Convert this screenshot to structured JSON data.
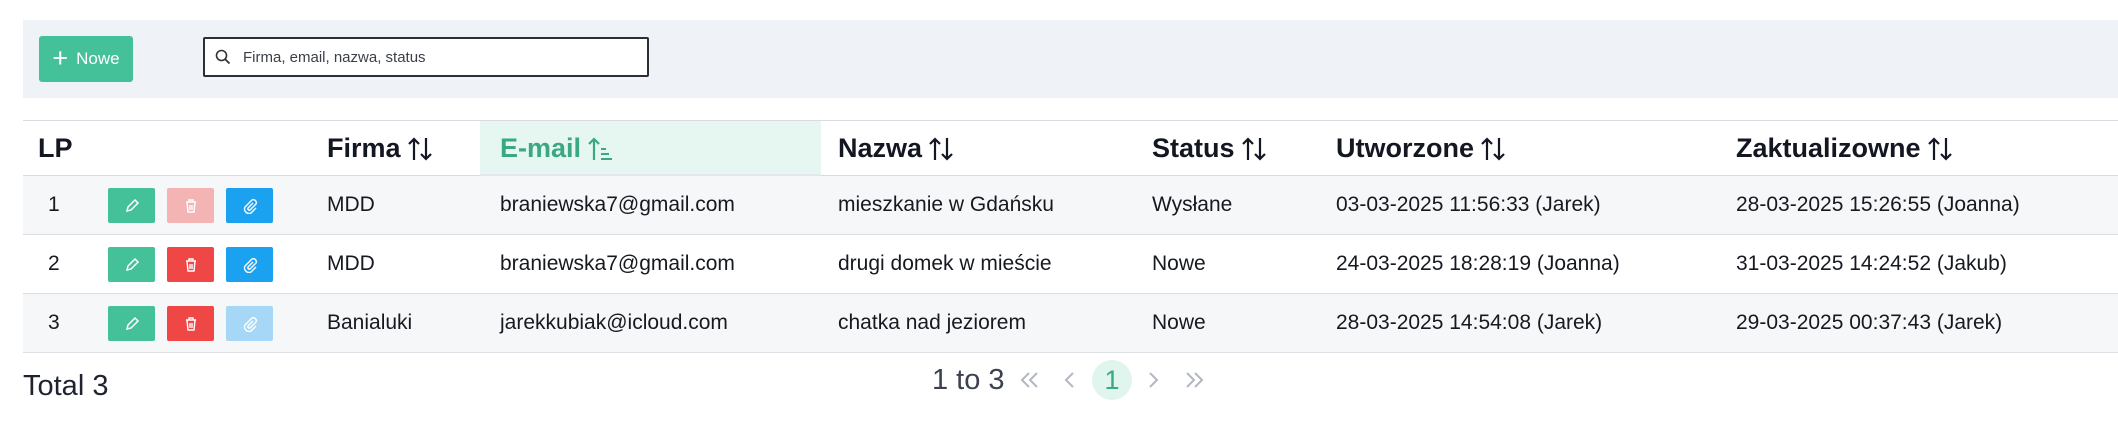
{
  "toolbar": {
    "new_label": "Nowe",
    "search_placeholder": "Firma, email, nazwa, status"
  },
  "table": {
    "headers": {
      "lp": "LP",
      "firma": "Firma",
      "email": "E-mail",
      "nazwa": "Nazwa",
      "status": "Status",
      "utworzone": "Utworzone",
      "zaktualizowne": "Zaktualizowne"
    },
    "active_sort_column": "email",
    "rows": [
      {
        "lp": "1",
        "firma": "MDD",
        "email": "braniewska7@gmail.com",
        "nazwa": "mieszkanie w Gdańsku",
        "status": "Wysłane",
        "utworzone": "03-03-2025 11:56:33 (Jarek)",
        "zaktualizowne": "28-03-2025 15:26:55 (Joanna)",
        "delete_enabled": false,
        "attach_enabled": true
      },
      {
        "lp": "2",
        "firma": "MDD",
        "email": "braniewska7@gmail.com",
        "nazwa": "drugi domek w mieście",
        "status": "Nowe",
        "utworzone": "24-03-2025 18:28:19 (Joanna)",
        "zaktualizowne": "31-03-2025 14:24:52 (Jakub)",
        "delete_enabled": true,
        "attach_enabled": true
      },
      {
        "lp": "3",
        "firma": "Banialuki",
        "email": "jarekkubiak@icloud.com",
        "nazwa": "chatka nad jeziorem",
        "status": "Nowe",
        "utworzone": "28-03-2025 14:54:08 (Jarek)",
        "zaktualizowne": "29-03-2025 00:37:43 (Jarek)",
        "delete_enabled": true,
        "attach_enabled": false
      }
    ]
  },
  "footer": {
    "total": "Total 3",
    "range": "1 to 3",
    "current_page": "1"
  },
  "colors": {
    "accent_green": "#45c19a",
    "danger_red": "#ef4646",
    "info_blue": "#1aa2f0"
  }
}
